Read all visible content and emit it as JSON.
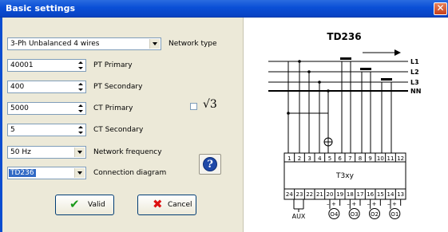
{
  "window": {
    "title": "Basic settings",
    "close_glyph": "✕"
  },
  "form": {
    "network_type": {
      "value": "3-Ph Unbalanced 4 wires",
      "label": "Network type"
    },
    "pt_primary": {
      "value": "40001",
      "label": "PT Primary"
    },
    "pt_secondary": {
      "value": "400",
      "label": "PT Secondary"
    },
    "ct_primary": {
      "value": "5000",
      "label": "CT Primary"
    },
    "ct_secondary": {
      "value": "5",
      "label": "CT Secondary"
    },
    "network_frequency": {
      "value": "50 Hz",
      "label": "Network frequency"
    },
    "connection_diagram": {
      "value": "TD236",
      "label": "Connection diagram"
    },
    "sqrt3": {
      "checked": false,
      "label": "√3"
    }
  },
  "buttons": {
    "help_glyph": "?",
    "valid": {
      "label": "Valid",
      "icon": "checkmark-icon",
      "glyph": "✔"
    },
    "cancel": {
      "label": "Cancel",
      "icon": "cross-icon",
      "glyph": "✖"
    }
  },
  "diagram": {
    "title": "TD236",
    "lines": [
      "L1",
      "L2",
      "L3",
      "NN"
    ],
    "top_terminals": [
      "1",
      "2",
      "3",
      "4",
      "5",
      "6",
      "7",
      "8",
      "9",
      "10",
      "11",
      "12"
    ],
    "bottom_terminals": [
      "24",
      "23",
      "22",
      "21",
      "20",
      "19",
      "18",
      "17",
      "16",
      "15",
      "14",
      "13"
    ],
    "device": "T3xy",
    "aux_label": "AUX",
    "outputs": [
      "O4",
      "O3",
      "O2",
      "O1"
    ],
    "polarity": [
      "–",
      "+",
      "–",
      "+",
      "–",
      "+",
      "–",
      "+"
    ]
  },
  "colors": {
    "title_bar": "#0a4fd6",
    "panel": "#ece9d8",
    "selection": "#316ac5"
  }
}
